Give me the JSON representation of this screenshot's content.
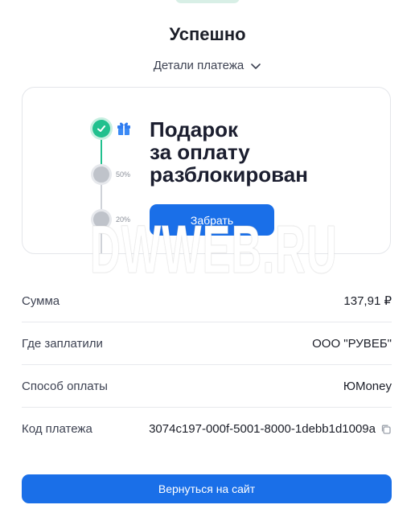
{
  "header": {
    "title": "Успешно",
    "details_label": "Детали платежа"
  },
  "gift": {
    "title": "Подарок\nза оплату\nразблокирован",
    "steps": [
      "50%",
      "20%"
    ],
    "claim_label": "Забрать"
  },
  "payment": {
    "rows": [
      {
        "label": "Сумма",
        "value": "137,91 ₽"
      },
      {
        "label": "Где заплатили",
        "value": "ООО \"РУВЕБ\""
      },
      {
        "label": "Способ оплаты",
        "value": "ЮMoney"
      },
      {
        "label": "Код платежа",
        "value": "3074c197-000f-5001-8000-1debb1d1009a"
      }
    ]
  },
  "footer": {
    "return_label": "Вернуться на сайт"
  },
  "watermark": "DWWEB.RU",
  "colors": {
    "accent": "#1a6fe8",
    "success": "#21c08e"
  }
}
